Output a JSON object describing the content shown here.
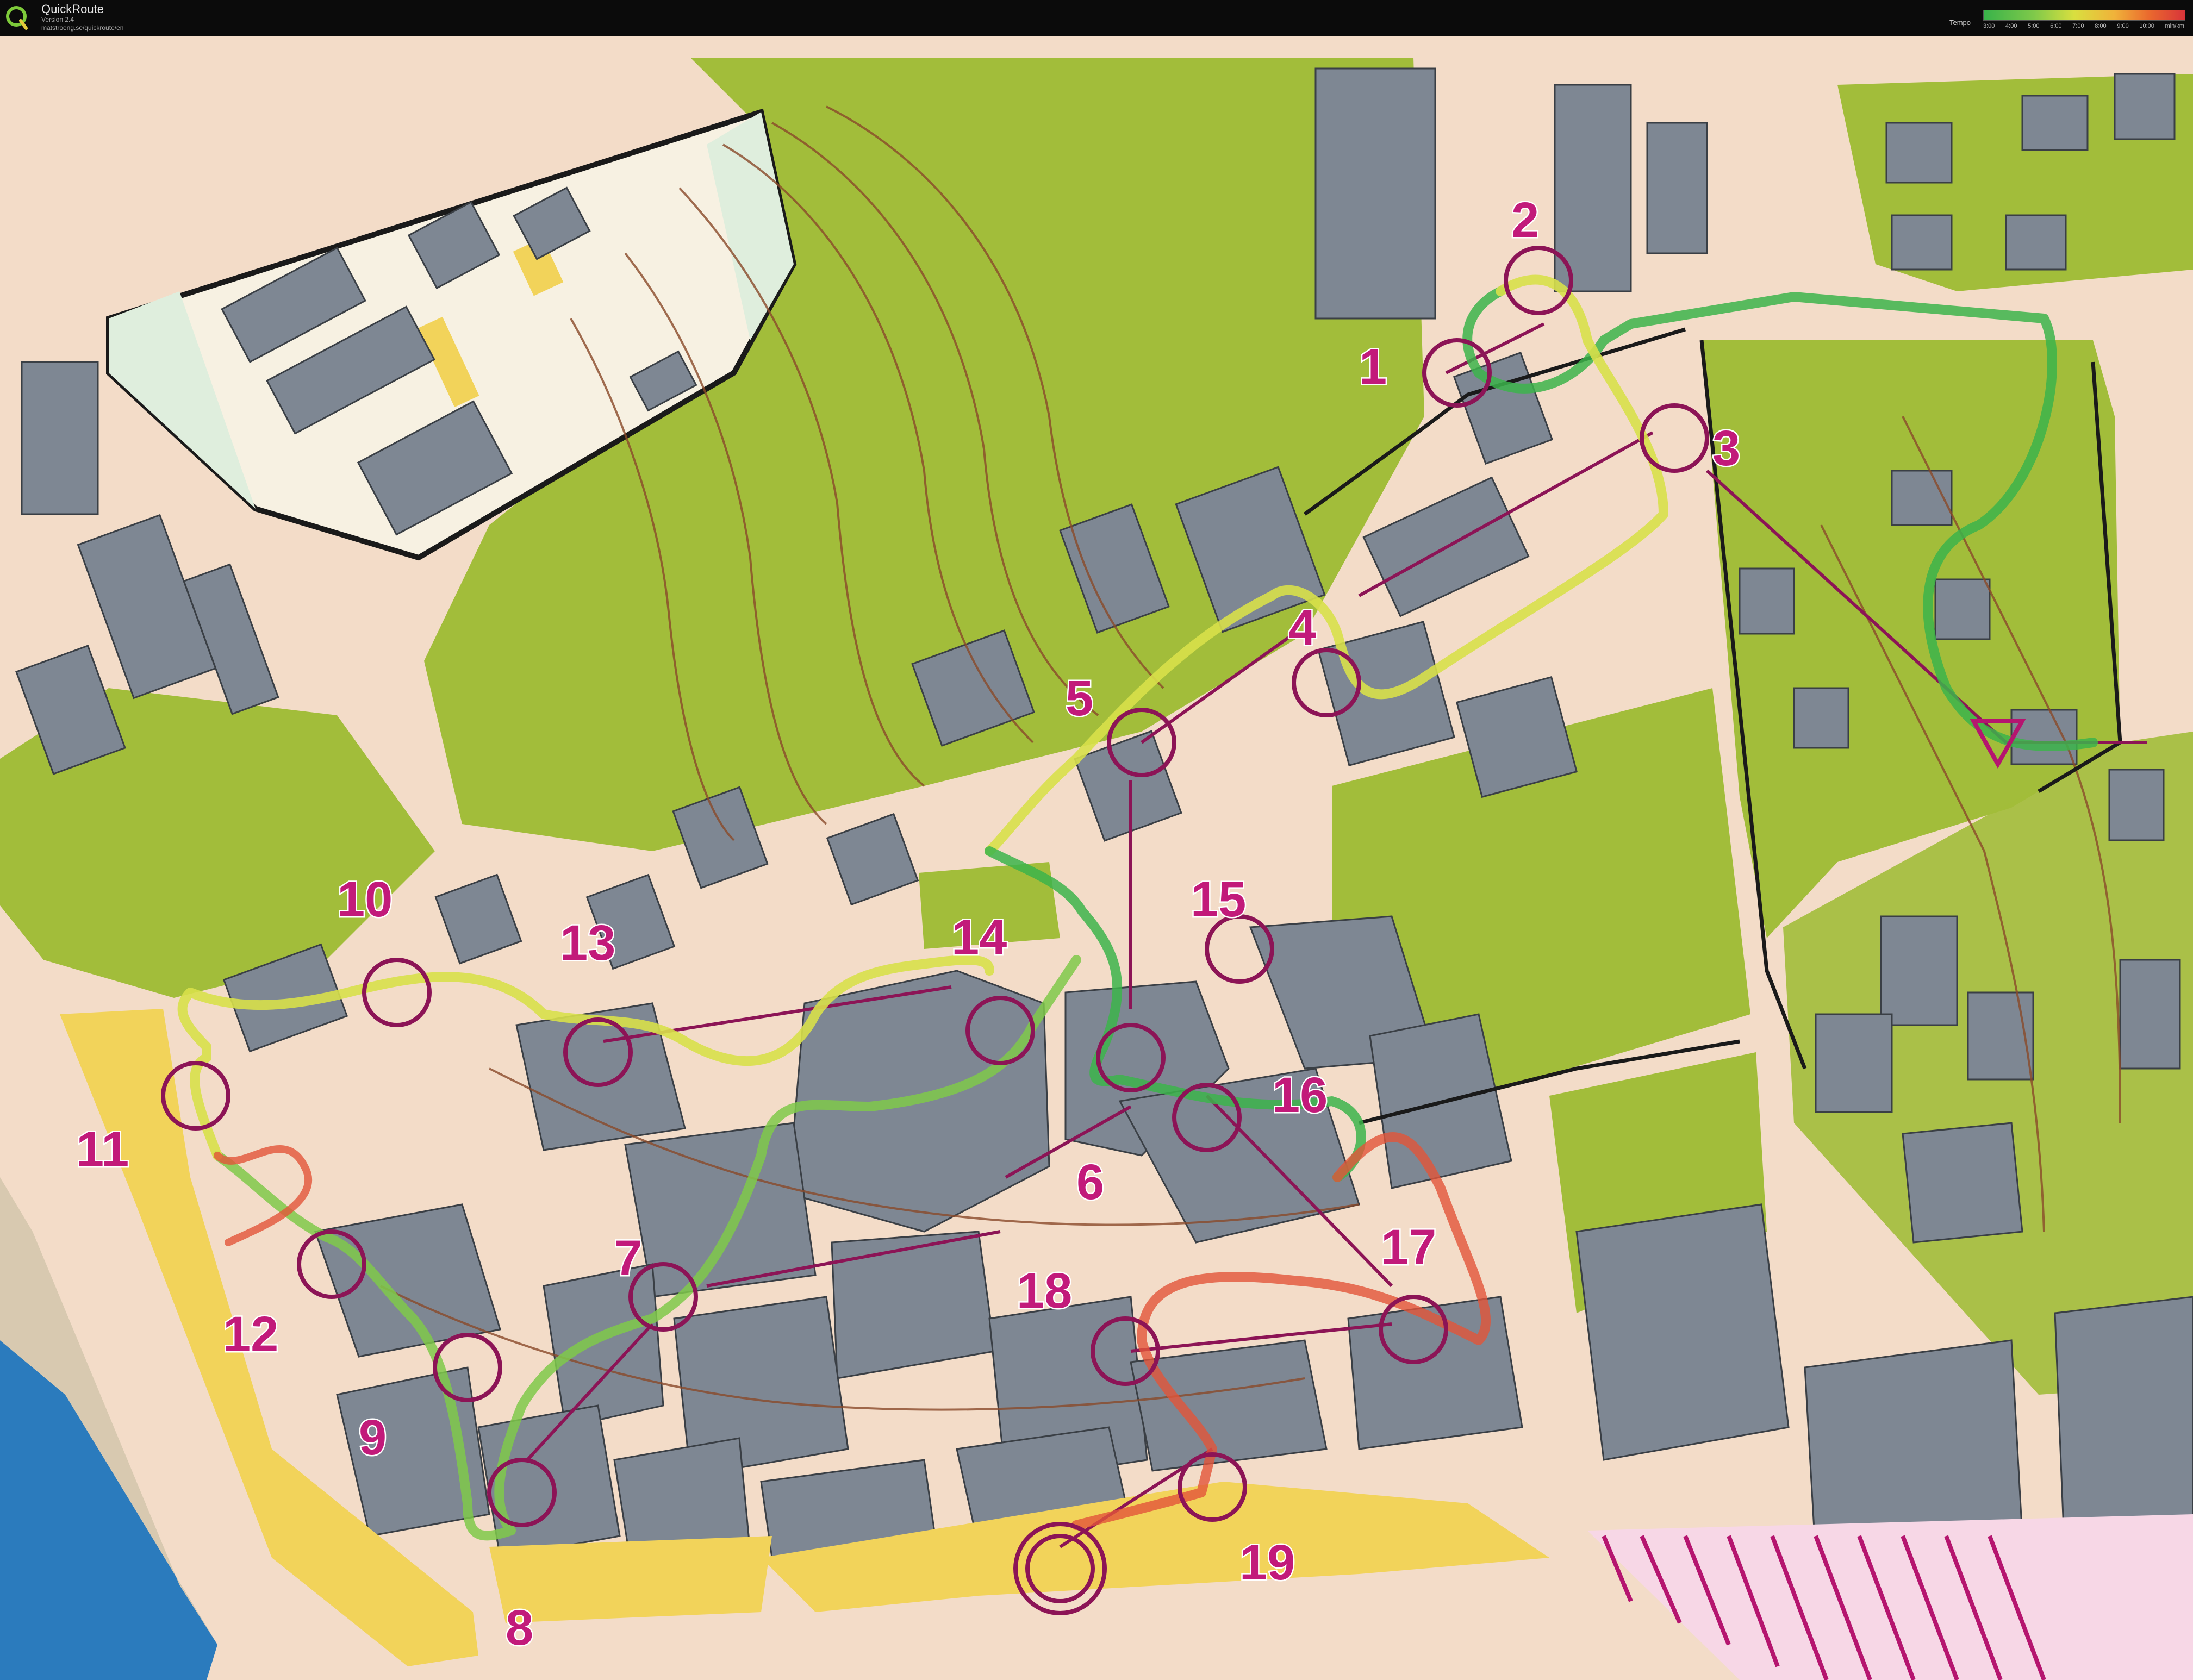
{
  "app": {
    "name": "QuickRoute",
    "version": "Version 2.4",
    "url": "matstroeng.se/quickroute/en"
  },
  "legend": {
    "title": "Tempo",
    "ticks": [
      "3:00",
      "4:00",
      "5:00",
      "6:00",
      "7:00",
      "8:00",
      "9:00",
      "10:00",
      "min/km"
    ]
  },
  "map": {
    "controls": [
      "1",
      "2",
      "3",
      "4",
      "5",
      "6",
      "7",
      "8",
      "9",
      "10",
      "11",
      "12",
      "13",
      "14",
      "15",
      "16",
      "17",
      "18",
      "19"
    ],
    "colors": {
      "vegetation": "#a2bd3a",
      "building": "#7e8793",
      "road": "#f3dcc8",
      "paved_yellow": "#f2d35a",
      "course": "#b5156f",
      "route_fast": "#3cb44b",
      "route_mid": "#d8e04a",
      "route_slow": "#e2553a",
      "water": "#2b7bbd",
      "contour": "#8a4a2a"
    }
  }
}
